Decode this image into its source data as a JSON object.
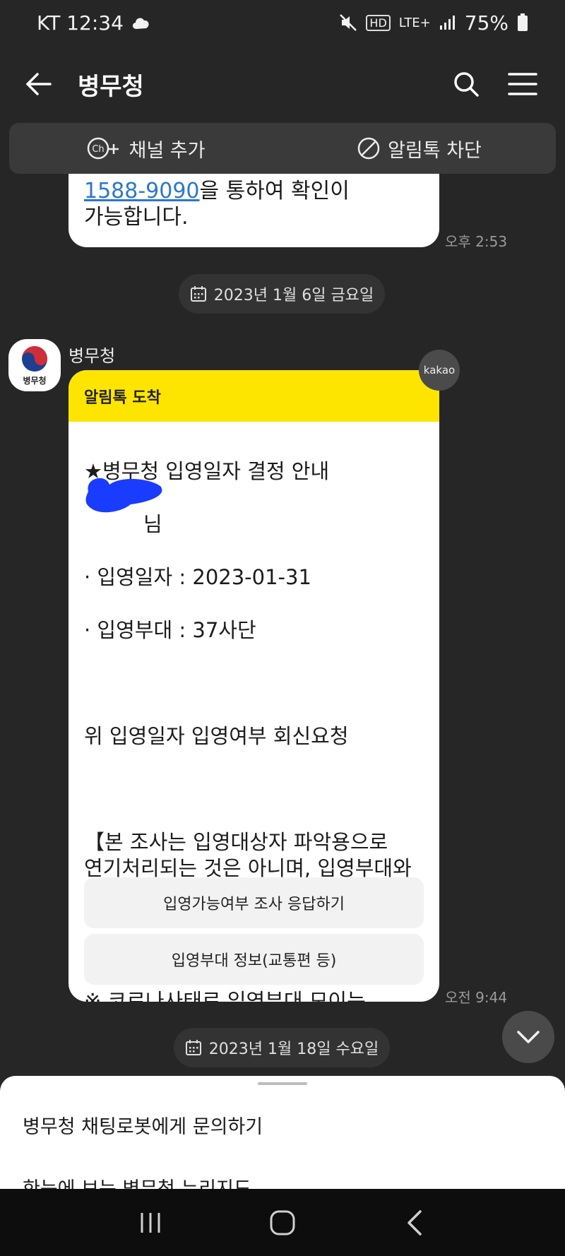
{
  "status": {
    "carrier_time": "KT 12:34",
    "network": "LTE+",
    "hd": "HD",
    "battery": "75%"
  },
  "header": {
    "title": "병무청"
  },
  "channel": {
    "add_label": "채널 추가",
    "add_icon_text": "Ch+",
    "block_label": "알림톡 차단"
  },
  "prev_message": {
    "link_text": "1588-9090",
    "line1_rest": "을 통하여 확인이",
    "line2": "가능합니다.",
    "time": "오후 2:53"
  },
  "date1": "2023년 1월 6일 금요일",
  "date2": "2023년 1월 18일 수요일",
  "sender": {
    "name": "병무청",
    "avatar_label": "병무청"
  },
  "kakao_badge": "kakao",
  "message": {
    "header": "알림톡 도착",
    "title": "★병무청 입영일자 결정 안내",
    "hidden_line": "님",
    "line_date": "· 입영일자 : 2023-01-31",
    "line_unit": "· 입영부대 : 37사단",
    "request": "위 입영일자 입영여부 회신요청",
    "note": "【본 조사는 입영대상자 파악용으로\n연기처리되는 것은 아니며, 입영부대와\n복무부대는 다를수 있음】",
    "covid": "※ 코로나사태로 입영부대 모이는\n장소가 변경된 부대가 있으니, 병무청\n누리집 입영부대 찾아가는길을\n확인하시기 바랍니다.",
    "button1": "입영가능여부 조사 응답하기",
    "button2": "입영부대 정보(교통편 등)",
    "time": "오전 9:44"
  },
  "sheet": {
    "item1": "병무청 채팅로봇에게 문의하기",
    "item2": "한눈에 보는 병무청 누리지도"
  }
}
